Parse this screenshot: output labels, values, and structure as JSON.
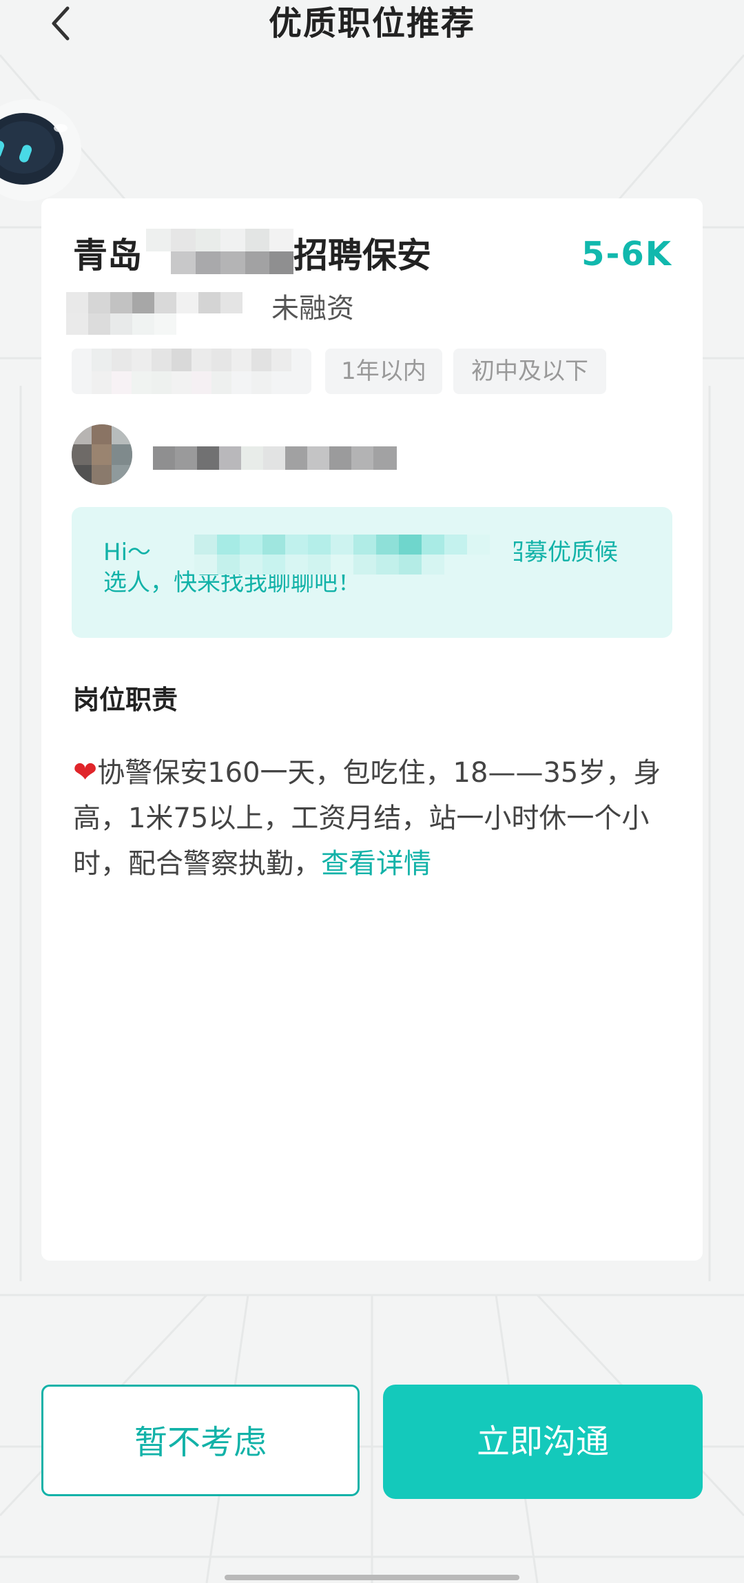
{
  "header": {
    "title": "优质职位推荐",
    "back_icon": "chevron-left-icon"
  },
  "job": {
    "title_prefix": "青岛",
    "title_suffix": "招聘保安",
    "salary": "5-6K",
    "funding": "未融资",
    "tags": [
      "1年以内",
      "初中及以下"
    ]
  },
  "greeting": {
    "prefix": "Hi～",
    "suffix": "正在招募优质候选人，快来找我聊聊吧！"
  },
  "duties": {
    "section_title": "岗位职责",
    "heart_icon": "heart-icon",
    "text": "协警保安160一天，包吃住，18——35岁，身高，1米75以上，工资月结，站一小时休一个小时，配合警察执勤，",
    "more_link": "查看详情"
  },
  "actions": {
    "decline": "暂不考虑",
    "chat": "立即沟通"
  },
  "colors": {
    "accent": "#12b2a8",
    "button": "#14c9bb",
    "greeting_bg": "#e1f8f6",
    "heart": "#e0252a"
  }
}
